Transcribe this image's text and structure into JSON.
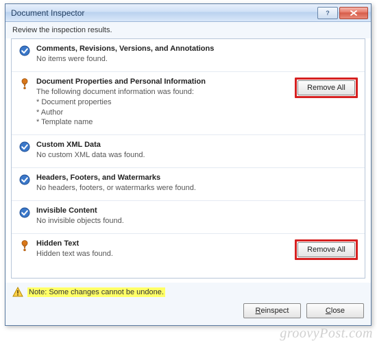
{
  "titlebar": {
    "title": "Document Inspector"
  },
  "subtitle": "Review the inspection results.",
  "sections": [
    {
      "status": "ok",
      "title": "Comments, Revisions, Versions, and Annotations",
      "desc": "No items were found.",
      "action": null
    },
    {
      "status": "warn",
      "title": "Document Properties and Personal Information",
      "desc": "The following document information was found:\n* Document properties\n* Author\n* Template name",
      "action": "Remove All",
      "highlight": true
    },
    {
      "status": "ok",
      "title": "Custom XML Data",
      "desc": "No custom XML data was found.",
      "action": null
    },
    {
      "status": "ok",
      "title": "Headers, Footers, and Watermarks",
      "desc": "No headers, footers, or watermarks were found.",
      "action": null
    },
    {
      "status": "ok",
      "title": "Invisible Content",
      "desc": "No invisible objects found.",
      "action": null
    },
    {
      "status": "warn",
      "title": "Hidden Text",
      "desc": "Hidden text was found.",
      "action": "Remove All",
      "highlight": true
    }
  ],
  "note": "Note: Some changes cannot be undone.",
  "buttons": {
    "reinspect_prefix": "R",
    "reinspect_rest": "einspect",
    "close_prefix": "C",
    "close_rest": "lose"
  },
  "watermark": "groovyPost.com"
}
